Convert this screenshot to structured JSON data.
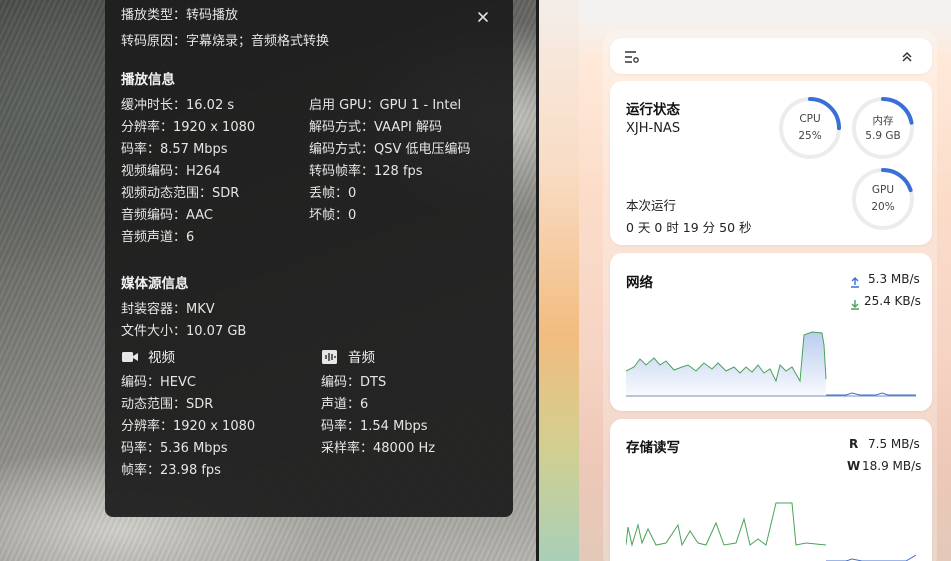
{
  "playback_panel": {
    "play_type": "播放类型：转码播放",
    "transcode_reason": "转码原因：字幕烧录；音频格式转换",
    "play_info_heading": "播放信息",
    "left_rows": [
      "缓冲时长：16.02 s",
      "分辨率：1920 x 1080",
      "码率：8.57 Mbps",
      "视频编码：H264",
      "视频动态范围：SDR",
      "音频编码：AAC",
      "音频声道：6"
    ],
    "right_rows": [
      "启用 GPU：GPU 1 - Intel",
      "解码方式：VAAPI 解码",
      "编码方式：QSV 低电压编码",
      "转码帧率：128 fps",
      "丢帧：0",
      "坏帧：0"
    ],
    "media_heading": "媒体源信息",
    "container": "封装容器：MKV",
    "file_size": "文件大小：10.07 GB",
    "video_label": "视频",
    "audio_label": "音频",
    "video_rows": [
      "编码：HEVC",
      "动态范围：SDR",
      "分辨率：1920 x 1080",
      "码率：5.36 Mbps",
      "帧率：23.98 fps"
    ],
    "audio_rows": [
      "编码：DTS",
      "声道：6",
      "码率：1.54 Mbps",
      "采样率：48000 Hz"
    ]
  },
  "dashboard": {
    "status_card": {
      "title": "运行状态",
      "host": "XJH-NAS",
      "uptime_label": "本次运行",
      "uptime_value": "0 天 0 时 19 分 50 秒",
      "gauges": [
        {
          "name": "CPU",
          "value": "25%",
          "fraction": 0.25
        },
        {
          "name": "内存",
          "value": "5.9 GB",
          "fraction": 0.22
        },
        {
          "name": "GPU",
          "value": "20%",
          "fraction": 0.2
        }
      ]
    },
    "network_card": {
      "title": "网络",
      "upload": "5.3 MB/s",
      "download": "25.4 KB/s"
    },
    "storage_card": {
      "title": "存储读写",
      "read_prefix": "R",
      "read": "7.5 MB/s",
      "write_prefix": "W",
      "write": "18.9 MB/s"
    },
    "colors": {
      "accent_blue": "#3a6fd6",
      "accent_green": "#4aa357",
      "gauge_track": "#ececec"
    }
  }
}
